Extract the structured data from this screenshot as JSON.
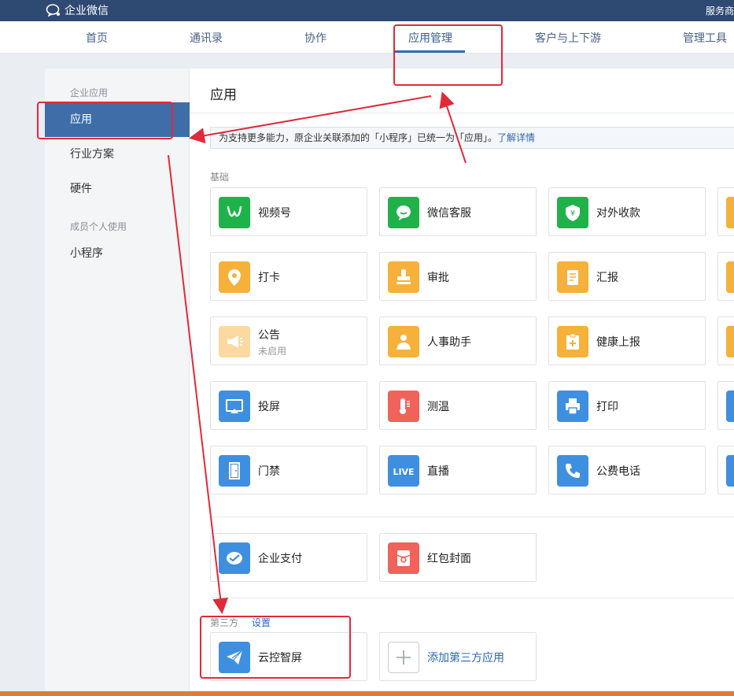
{
  "app": {
    "name": "企业微信",
    "top_right": "服务商"
  },
  "nav": {
    "items": [
      {
        "label": "首页"
      },
      {
        "label": "通讯录"
      },
      {
        "label": "协作"
      },
      {
        "label": "应用管理",
        "active": true
      },
      {
        "label": "客户与上下游"
      },
      {
        "label": "管理工具"
      }
    ]
  },
  "sidebar": {
    "group1": "企业应用",
    "items1": [
      {
        "label": "应用",
        "active": true
      },
      {
        "label": "行业方案"
      },
      {
        "label": "硬件"
      }
    ],
    "group2": "成员个人使用",
    "items2": [
      {
        "label": "小程序"
      }
    ]
  },
  "main": {
    "title": "应用",
    "notice": "为支持更多能力，原企业关联添加的「小程序」已统一为「应用」。",
    "notice_link": "了解详情",
    "section_basic": "基础",
    "basic_apps": [
      {
        "name": "视频号",
        "icon": "channels-icon",
        "color": "#1fb24a"
      },
      {
        "name": "微信客服",
        "icon": "wechat-service-icon",
        "color": "#1fb24a"
      },
      {
        "name": "对外收款",
        "icon": "payment-shield-icon",
        "color": "#1fb24a"
      },
      {
        "name": "打卡",
        "icon": "location-pin-icon",
        "color": "#f5b13a"
      },
      {
        "name": "审批",
        "icon": "stamp-icon",
        "color": "#f5b13a"
      },
      {
        "name": "汇报",
        "icon": "report-icon",
        "color": "#f5b13a"
      },
      {
        "name": "公告",
        "sub": "未启用",
        "icon": "megaphone-icon",
        "color": "#fbd9a0"
      },
      {
        "name": "人事助手",
        "icon": "person-icon",
        "color": "#f5b13a"
      },
      {
        "name": "健康上报",
        "icon": "clipboard-plus-icon",
        "color": "#f5b13a"
      },
      {
        "name": "投屏",
        "icon": "screen-cast-icon",
        "color": "#3f8fe0"
      },
      {
        "name": "测温",
        "icon": "thermometer-icon",
        "color": "#f0625a"
      },
      {
        "name": "打印",
        "icon": "printer-icon",
        "color": "#3f8fe0"
      },
      {
        "name": "门禁",
        "icon": "door-icon",
        "color": "#3f8fe0"
      },
      {
        "name": "直播",
        "icon": "live-icon",
        "icon_text": "LIVE",
        "color": "#3f8fe0"
      },
      {
        "name": "公费电话",
        "icon": "phone-icon",
        "color": "#3f8fe0"
      }
    ],
    "extra_apps": [
      {
        "name": "企业支付",
        "icon": "enterprise-pay-icon",
        "color": "#3f8fe0"
      },
      {
        "name": "红包封面",
        "icon": "red-packet-icon",
        "color": "#f0625a"
      }
    ],
    "section_third": "第三方",
    "third_setting": "设置",
    "third_apps": [
      {
        "name": "云控智屏",
        "icon": "paper-plane-icon",
        "color": "#3f8fe0"
      }
    ],
    "add_third": "添加第三方应用"
  }
}
